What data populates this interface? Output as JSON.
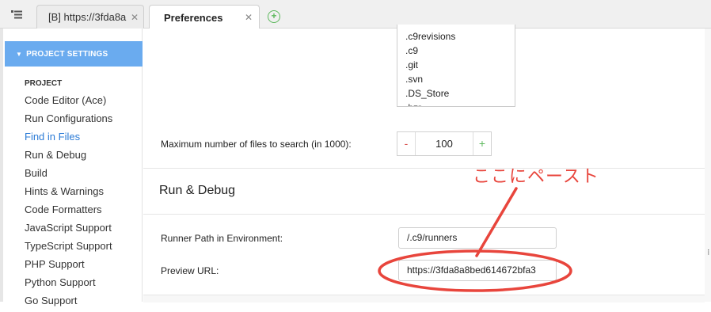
{
  "tabs": [
    {
      "label": "[B] https://3fda8a",
      "close": "✕",
      "active": false
    },
    {
      "label": "Preferences",
      "close": "✕",
      "active": true
    }
  ],
  "add_tab_label": "+",
  "sidebar": {
    "section_header": "PROJECT SETTINGS",
    "group_title": "PROJECT",
    "items": [
      {
        "label": "Code Editor (Ace)",
        "active": false
      },
      {
        "label": "Run Configurations",
        "active": false
      },
      {
        "label": "Find in Files",
        "active": true
      },
      {
        "label": "Run & Debug",
        "active": false
      },
      {
        "label": "Build",
        "active": false
      },
      {
        "label": "Hints & Warnings",
        "active": false
      },
      {
        "label": "Code Formatters",
        "active": false
      },
      {
        "label": "JavaScript Support",
        "active": false
      },
      {
        "label": "TypeScript Support",
        "active": false
      },
      {
        "label": "PHP Support",
        "active": false
      },
      {
        "label": "Python Support",
        "active": false
      },
      {
        "label": "Go Support",
        "active": false
      }
    ]
  },
  "find_in_files": {
    "excluded": [
      ".c9revisions",
      ".c9",
      ".git",
      ".svn",
      ".DS_Store",
      ".bzr"
    ],
    "max_files_label": "Maximum number of files to search (in 1000):",
    "max_files": {
      "minus": "-",
      "value": "100",
      "plus": "+"
    }
  },
  "run_debug": {
    "title": "Run & Debug",
    "runner_path_label": "Runner Path in Environment:",
    "runner_path_value": "/.c9/runners",
    "preview_url_label": "Preview URL:",
    "preview_url_value": "https://3fda8a8bed614672bfa3"
  },
  "annotation": {
    "text": "ここにペースト",
    "color": "#e8453c"
  },
  "colors": {
    "accent": "#6aabef",
    "link_active": "#2b7bd6",
    "plus": "#5cb85c",
    "minus": "#d9534f"
  }
}
